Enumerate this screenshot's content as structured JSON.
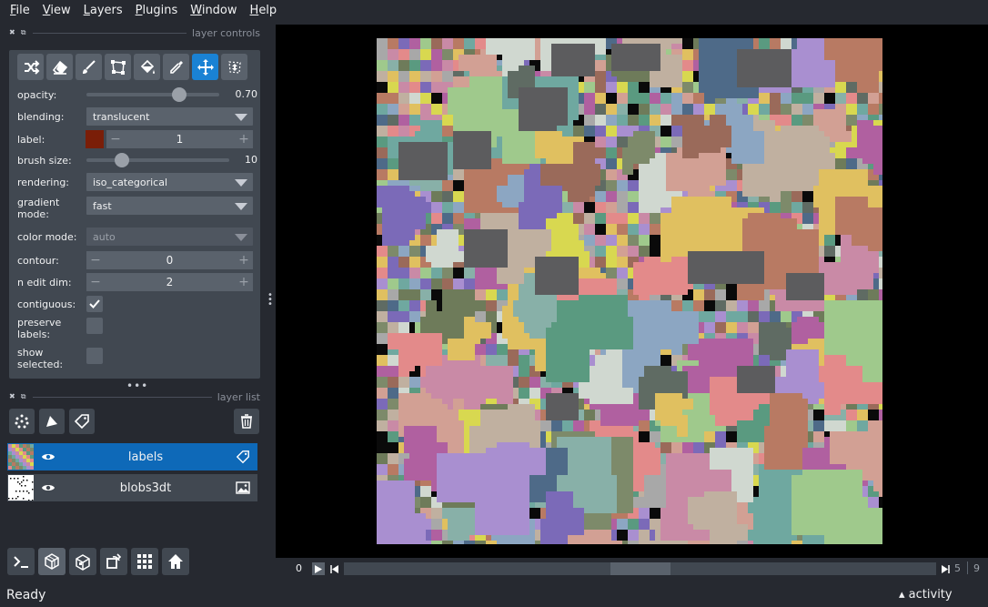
{
  "menu": [
    "File",
    "View",
    "Layers",
    "Plugins",
    "Window",
    "Help"
  ],
  "dock": {
    "layer_controls_title": "layer controls",
    "layer_list_title": "layer list"
  },
  "tools": [
    {
      "name": "shuffle-colors",
      "icon": "shuffle-icon"
    },
    {
      "name": "erase",
      "icon": "eraser-icon"
    },
    {
      "name": "paint",
      "icon": "paintbrush-icon"
    },
    {
      "name": "polygon",
      "icon": "polygon-icon"
    },
    {
      "name": "fill",
      "icon": "fill-bucket-icon"
    },
    {
      "name": "pick",
      "icon": "color-picker-icon"
    },
    {
      "name": "pan-zoom",
      "icon": "move-icon",
      "active": true
    },
    {
      "name": "transform",
      "icon": "transform-icon"
    }
  ],
  "controls": {
    "opacity_label": "opacity:",
    "opacity_value": "0.70",
    "opacity_fraction": 0.7,
    "blending_label": "blending:",
    "blending_value": "translucent",
    "label_label": "label:",
    "label_value": "1",
    "label_color": "#7a1e08",
    "brush_size_label": "brush size:",
    "brush_size_value": "10",
    "brush_size_fraction": 0.25,
    "rendering_label": "rendering:",
    "rendering_value": "iso_categorical",
    "gradient_mode_label": "gradient mode:",
    "gradient_mode_value": "fast",
    "color_mode_label": "color mode:",
    "color_mode_value": "auto",
    "contour_label": "contour:",
    "contour_value": "0",
    "n_edit_dim_label": "n edit dim:",
    "n_edit_dim_value": "2",
    "contiguous_label": "contiguous:",
    "contiguous_checked": true,
    "preserve_labels_label": "preserve labels:",
    "preserve_labels_checked": false,
    "show_selected_label": "show selected:",
    "show_selected_checked": false
  },
  "layers": [
    {
      "name": "labels",
      "type_icon": "label-tag-icon",
      "selected": true,
      "visible": true
    },
    {
      "name": "blobs3dt",
      "type_icon": "image-icon",
      "selected": false,
      "visible": true
    }
  ],
  "dims": {
    "index": "0",
    "current": "5",
    "max": "9",
    "position_fraction": 0.5
  },
  "status": {
    "text": "Ready",
    "activity": "activity"
  }
}
